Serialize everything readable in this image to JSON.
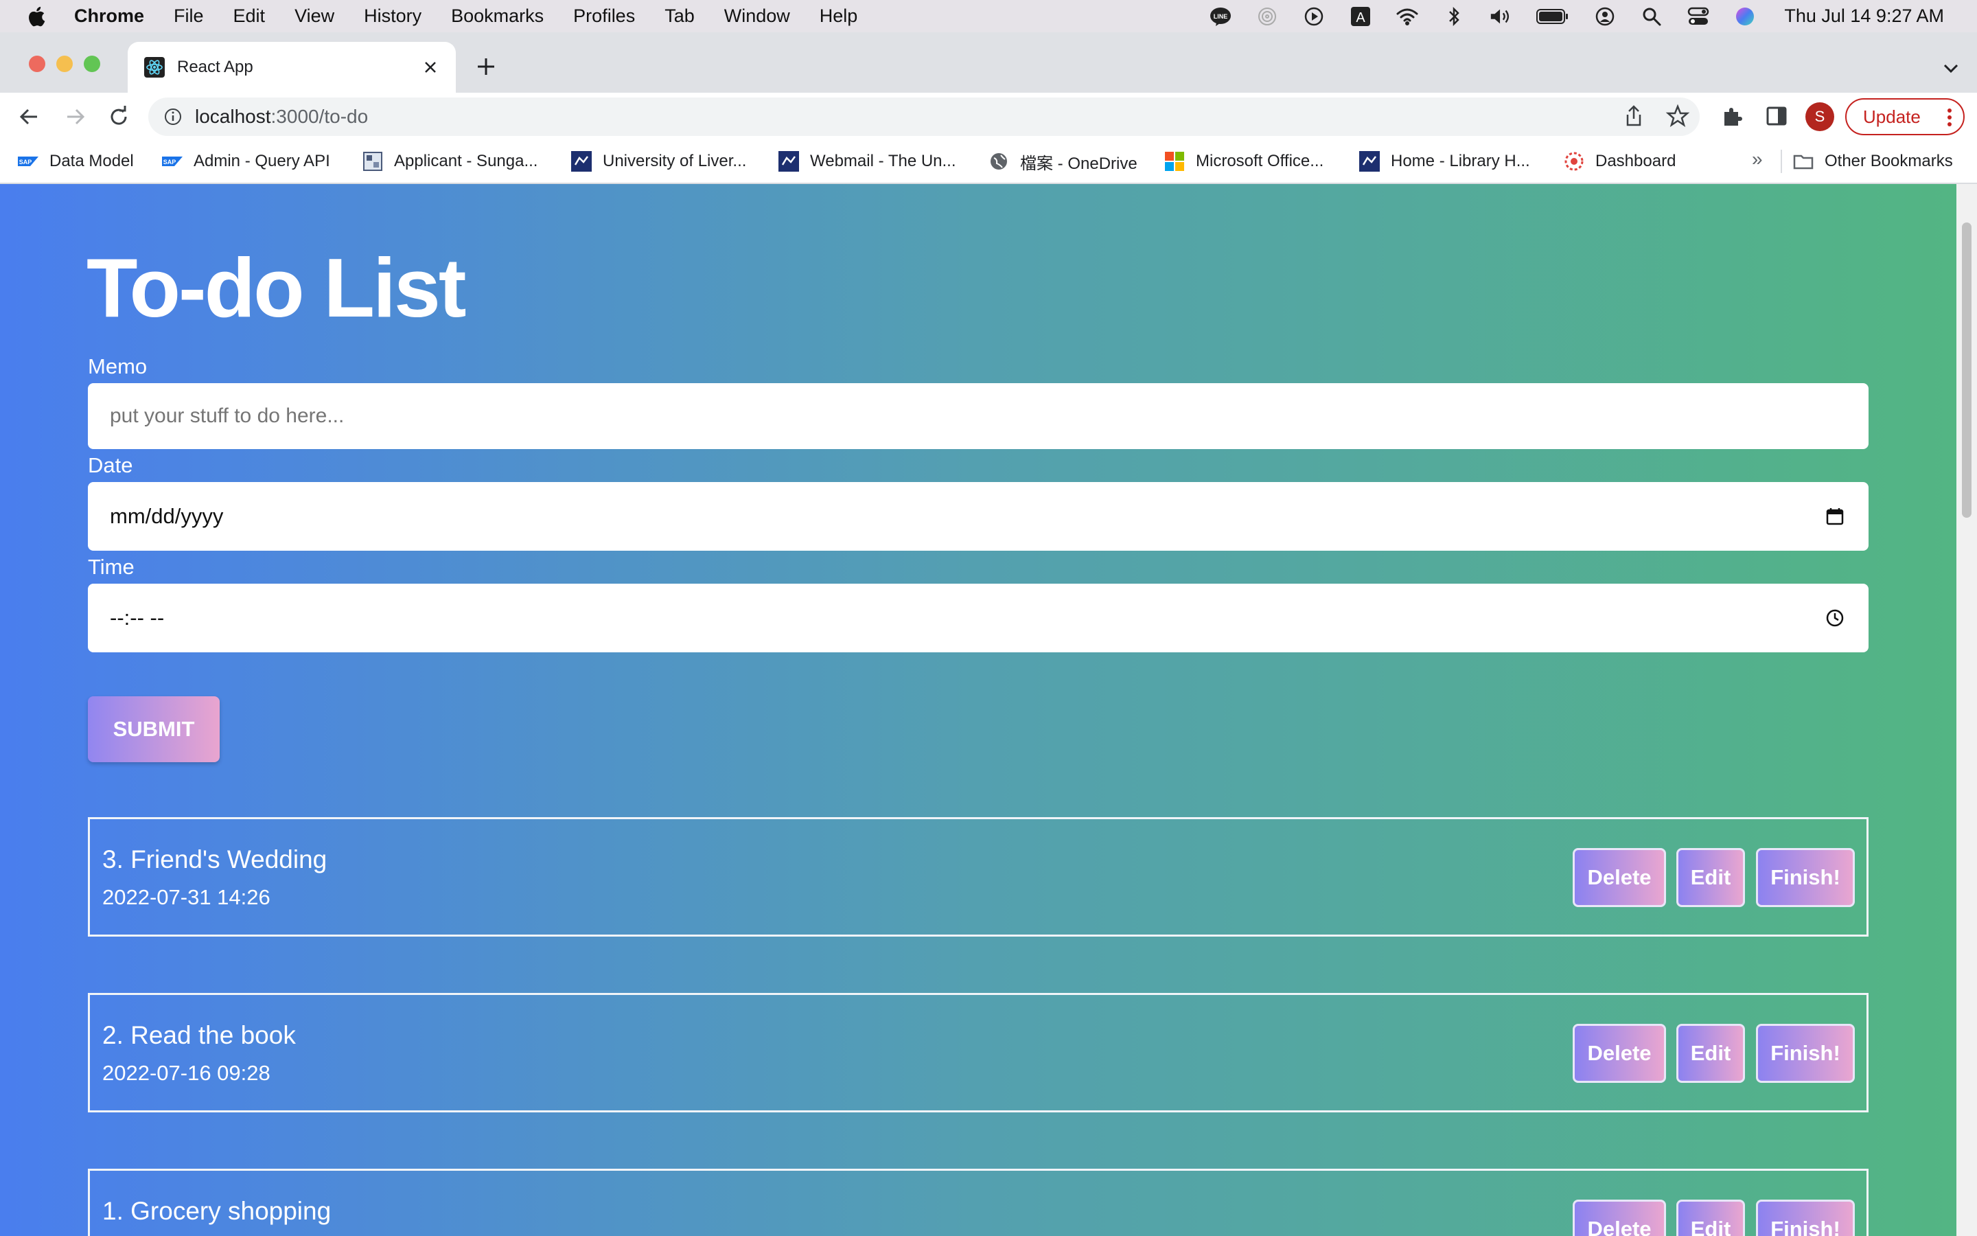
{
  "os_menubar": {
    "app": "Chrome",
    "items": [
      "File",
      "Edit",
      "View",
      "History",
      "Bookmarks",
      "Profiles",
      "Tab",
      "Window",
      "Help"
    ],
    "clock": "Thu Jul 14  9:27 AM",
    "status_icons": [
      "line-icon",
      "airdrop-icon",
      "play-icon",
      "input-source-icon",
      "wifi-icon",
      "bluetooth-icon",
      "volume-icon",
      "battery-icon",
      "user-icon",
      "spotlight-icon",
      "control-center-icon",
      "siri-icon"
    ],
    "input_source_letter": "A"
  },
  "browser": {
    "tab_title": "React App",
    "url_host": "localhost",
    "url_path": ":3000/to-do",
    "profile_initial": "S",
    "update_label": "Update",
    "bookmarks": [
      "Data Model",
      "Admin - Query API",
      "Applicant - Sunga...",
      "University of Liver...",
      "Webmail - The Un...",
      "檔案 - OneDrive",
      "Microsoft Office...",
      "Home - Library H...",
      "Dashboard"
    ],
    "bookmarks_more": "»",
    "other_bookmarks": "Other Bookmarks"
  },
  "app": {
    "title": "To-do List",
    "memo_label": "Memo",
    "memo_placeholder": "put your stuff to do here...",
    "date_label": "Date",
    "date_value": "mm/dd/yyyy",
    "time_label": "Time",
    "time_value": "--:-- --",
    "submit_label": "SUBMIT",
    "todos": [
      {
        "title": "3. Friend's Wedding",
        "datetime": "2022-07-31 14:26"
      },
      {
        "title": "2. Read the book",
        "datetime": "2022-07-16 09:28"
      },
      {
        "title": "1. Grocery shopping",
        "datetime": ""
      }
    ],
    "delete_label": "Delete",
    "edit_label": "Edit",
    "finish_label": "Finish!"
  },
  "colors": {
    "gradient_start": "#4a7eee",
    "gradient_end": "#53b583",
    "button_gradient_start": "#8c82f0",
    "button_gradient_end": "#e9a6d0"
  }
}
